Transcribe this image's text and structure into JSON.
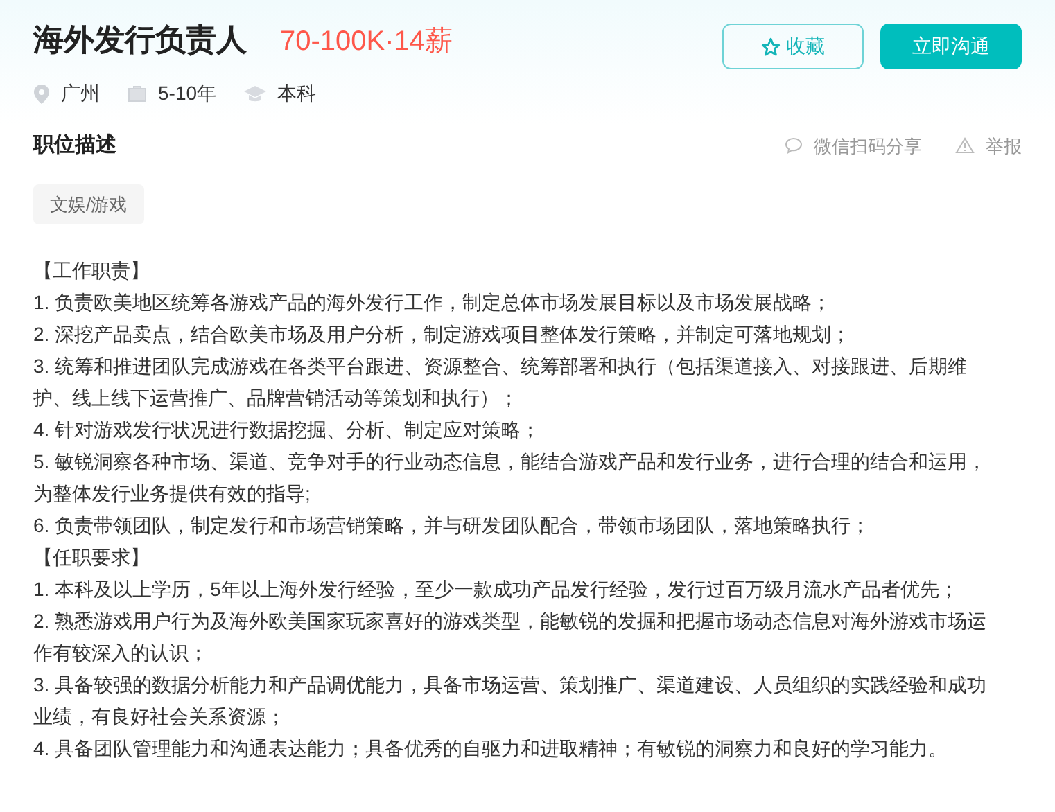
{
  "job": {
    "title": "海外发行负责人",
    "salary": "70-100K·14薪",
    "meta": [
      {
        "kind": "location",
        "text": "广州"
      },
      {
        "kind": "experience",
        "text": "5-10年"
      },
      {
        "kind": "degree",
        "text": "本科"
      }
    ]
  },
  "actions": {
    "favorite": "收藏",
    "chat": "立即沟通"
  },
  "section": {
    "title": "职位描述",
    "share": "微信扫码分享",
    "report": "举报"
  },
  "tags": [
    "文娱/游戏"
  ],
  "description": [
    "【工作职责】",
    "1. 负责欧美地区统筹各游戏产品的海外发行工作，制定总体市场发展目标以及市场发展战略；",
    "2. 深挖产品卖点，结合欧美市场及用户分析，制定游戏项目整体发行策略，并制定可落地规划；",
    "3. 统筹和推进团队完成游戏在各类平台跟进、资源整合、统筹部署和执行（包括渠道接入、对接跟进、后期维护、线上线下运营推广、品牌营销活动等策划和执行）；",
    "4. 针对游戏发行状况进行数据挖掘、分析、制定应对策略；",
    "5. 敏锐洞察各种市场、渠道、竞争对手的行业动态信息，能结合游戏产品和发行业务，进行合理的结合和运用，为整体发行业务提供有效的指导;",
    "6. 负责带领团队，制定发行和市场营销策略，并与研发团队配合，带领市场团队，落地策略执行；",
    "【任职要求】",
    "1. 本科及以上学历，5年以上海外发行经验，至少一款成功产品发行经验，发行过百万级月流水产品者优先；",
    "2. 熟悉游戏用户行为及海外欧美国家玩家喜好的游戏类型，能敏锐的发掘和把握市场动态信息对海外游戏市场运作有较深入的认识；",
    "3. 具备较强的数据分析能力和产品调优能力，具备市场运营、策划推广、渠道建设、人员组织的实践经验和成功业绩，有良好社会关系资源；",
    "4. 具备团队管理能力和沟通表达能力；具备优秀的自驱力和进取精神；有敏锐的洞察力和良好的学习能力。"
  ]
}
